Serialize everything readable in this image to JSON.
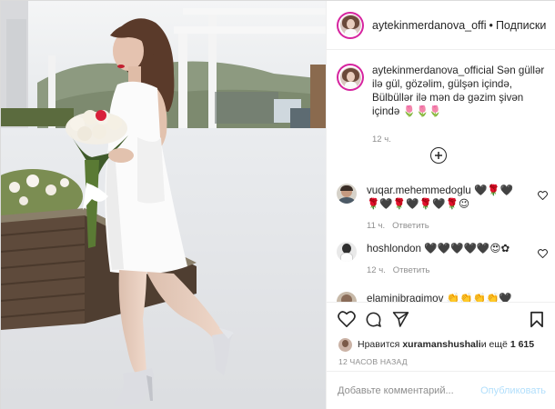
{
  "header": {
    "username": "aytekinmerdanova_offi",
    "separator": "•",
    "follow_label": "Подписки"
  },
  "caption": {
    "author": "aytekinmerdanova_official",
    "text": " Sən güllər ilə gül, gözəlim, gülşən içində, Bülbüllər ilə mən də gəzim şivən içində 🌷🌷🌷",
    "time": "12 ч."
  },
  "load_more_icon": "plus-circle-icon",
  "comments": [
    {
      "author": "vuqar.mehemmedoglu",
      "text": " 🖤🌹🖤🌹🖤🌹🖤🌹🖤🌹😉",
      "time": "11 ч.",
      "reply_label": "Ответить"
    },
    {
      "author": "hoshlondon",
      "text": " 🖤🖤🖤🖤🖤😍✿",
      "time": "12 ч.",
      "reply_label": "Ответить"
    },
    {
      "author": "elaminibragimov",
      "text": " 👏👏👏👏🖤"
    }
  ],
  "actions": {
    "like_icon": "heart-icon",
    "comment_icon": "comment-icon",
    "share_icon": "paper-plane-icon",
    "save_icon": "bookmark-icon"
  },
  "likes": {
    "prefix": "Нравится",
    "user": "xuramanshushali",
    "suffix": " и ещё",
    "count": "1 615"
  },
  "post_date": "12 ЧАСОВ НАЗАД",
  "add_comment": {
    "placeholder": "Добавьте комментарий...",
    "publish_label": "Опубликовать"
  },
  "colors": {
    "story_ring": "#d6249f",
    "publish_disabled": "#b2dffc",
    "muted_text": "#8e8e8e"
  }
}
